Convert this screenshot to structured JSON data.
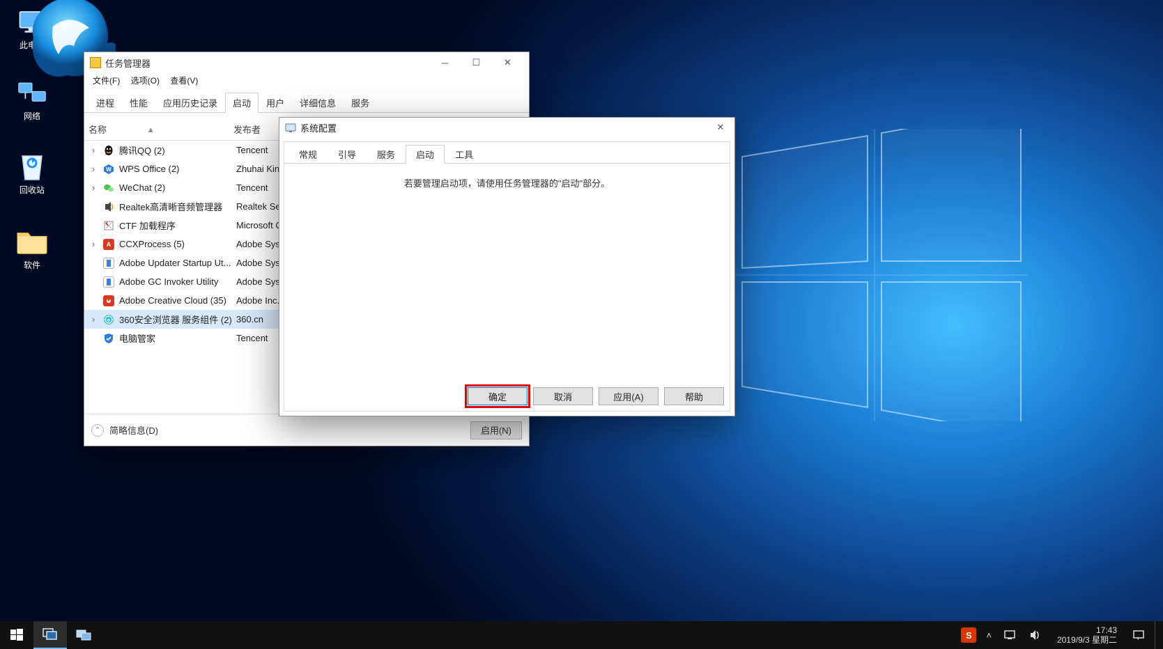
{
  "desktop": {
    "icons": [
      {
        "label": "此电脑"
      },
      {
        "label": "网络"
      },
      {
        "label": "回收站"
      },
      {
        "label": "软件"
      }
    ]
  },
  "taskManager": {
    "title": "任务管理器",
    "menu": {
      "file": "文件(F)",
      "options": "选项(O)",
      "view": "查看(V)"
    },
    "tabs": {
      "processes": "进程",
      "performance": "性能",
      "appHistory": "应用历史记录",
      "startup": "启动",
      "users": "用户",
      "details": "详细信息",
      "services": "服务"
    },
    "columns": {
      "name": "名称",
      "publisher": "发布者"
    },
    "rows": [
      {
        "expand": true,
        "icon": "qq",
        "name": "腾讯QQ (2)",
        "publisher": "Tencent"
      },
      {
        "expand": true,
        "icon": "wps",
        "name": "WPS Office (2)",
        "publisher": "Zhuhai King"
      },
      {
        "expand": true,
        "icon": "wechat",
        "name": "WeChat (2)",
        "publisher": "Tencent"
      },
      {
        "expand": false,
        "icon": "realtek",
        "name": "Realtek高清晰音频管理器",
        "publisher": "Realtek Sem"
      },
      {
        "expand": false,
        "icon": "ctf",
        "name": "CTF 加载程序",
        "publisher": "Microsoft Co"
      },
      {
        "expand": true,
        "icon": "ccx",
        "name": "CCXProcess (5)",
        "publisher": "Adobe Syste"
      },
      {
        "expand": false,
        "icon": "adobeu",
        "name": "Adobe Updater Startup Ut...",
        "publisher": "Adobe Syste"
      },
      {
        "expand": false,
        "icon": "adobegc",
        "name": "Adobe GC Invoker Utility",
        "publisher": "Adobe Syste"
      },
      {
        "expand": false,
        "icon": "acc",
        "name": "Adobe Creative Cloud (35)",
        "publisher": "Adobe Inc."
      },
      {
        "expand": true,
        "icon": "360",
        "name": "360安全浏览器 服务组件 (2)",
        "publisher": "360.cn",
        "selected": true
      },
      {
        "expand": false,
        "icon": "qqmgr",
        "name": "电脑管家",
        "publisher": "Tencent"
      }
    ],
    "footer": {
      "brief": "简略信息(D)",
      "enable": "启用(N)"
    }
  },
  "msconfig": {
    "title": "系统配置",
    "tabs": {
      "general": "常规",
      "boot": "引导",
      "services": "服务",
      "startup": "启动",
      "tools": "工具"
    },
    "message": "若要管理启动项，请使用任务管理器的\"启动\"部分。",
    "buttons": {
      "ok": "确定",
      "cancel": "取消",
      "apply": "应用(A)",
      "help": "帮助"
    }
  },
  "taskbar": {
    "time": "17:43",
    "date": "2019/9/3 星期二"
  }
}
